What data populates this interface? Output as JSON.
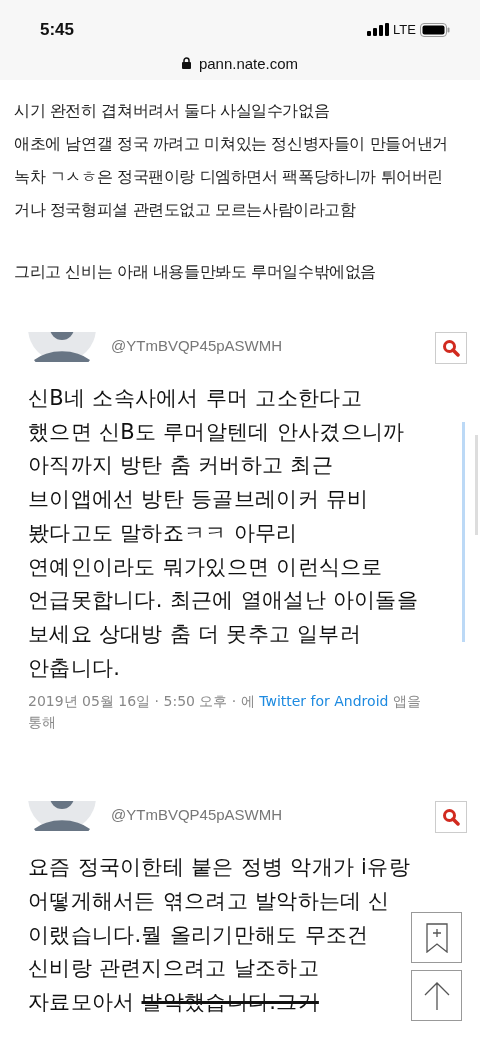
{
  "status_bar": {
    "time": "5:45",
    "network": "LTE"
  },
  "address_bar": {
    "url": "pann.nate.com"
  },
  "post": {
    "paragraphs": [
      {
        "lines": [
          "시기 완전히 겹쳐버려서 둘다 사실일수가없음",
          "애초에 남연갤 정국 까려고 미쳐있는 정신병자들이 만들어낸거",
          "녹차 ㄱㅅㅎ은 정국팬이랑 디엠하면서 팩폭당하니까 튀어버린",
          "거나 정국형피셜 관련도없고 모르는사람이라고함"
        ]
      },
      {
        "lines": [
          "그리고 신비는 아래 내용들만봐도 루머일수밖에없음"
        ]
      }
    ]
  },
  "tweets": [
    {
      "handle": "@YTmBVQP45pASWMH",
      "lines": [
        {
          "segments": [
            {
              "text": "신B네 소속사에서 루머 고소한다고",
              "struck": false
            }
          ]
        },
        {
          "segments": [
            {
              "text": "했으면 신B도 루머알텐데 안사겼으니까",
              "struck": false
            }
          ]
        },
        {
          "segments": [
            {
              "text": "아직까지 방탄 춤 커버하고 최근",
              "struck": false
            }
          ]
        },
        {
          "segments": [
            {
              "text": "브이앱에선 방탄 등골브레이커 뮤비",
              "struck": false
            }
          ]
        },
        {
          "segments": [
            {
              "text": "봤다고도 말하죠ㅋㅋ 아무리",
              "struck": false
            }
          ]
        },
        {
          "segments": [
            {
              "text": "연예인이라도 뭐가있으면 이런식으로",
              "struck": false
            }
          ]
        },
        {
          "segments": [
            {
              "text": "언급못합니다. 최근에 열애설난 아이돌을",
              "struck": false
            }
          ]
        },
        {
          "segments": [
            {
              "text": "보세요 상대방 춤 더 못추고 일부러",
              "struck": false
            }
          ]
        },
        {
          "segments": [
            {
              "text": "안춥니다.",
              "struck": false
            }
          ]
        }
      ],
      "meta": {
        "date": "2019년 05월 16일 · 5:50 오후 · 에",
        "source": "Twitter for Android",
        "suffix": "앱을 통해"
      }
    },
    {
      "handle": "@YTmBVQP45pASWMH",
      "lines": [
        {
          "segments": [
            {
              "text": "요즘 정국이한테 붙은 정병 악개가 i유랑",
              "struck": false
            }
          ]
        },
        {
          "segments": [
            {
              "text": "어떻게해서든 엮으려고 발악하는데 신",
              "struck": false
            }
          ]
        },
        {
          "segments": [
            {
              "text": "이랬습니다.뭘 올리기만해도 무조건",
              "struck": false
            }
          ]
        },
        {
          "segments": [
            {
              "text": "신비랑 관련지으려고 날조하고",
              "struck": false
            }
          ]
        },
        {
          "segments": [
            {
              "text": "자료모아서 ",
              "struck": false
            },
            {
              "text": "발악했습니다.그거",
              "struck": true
            }
          ]
        }
      ]
    }
  ]
}
